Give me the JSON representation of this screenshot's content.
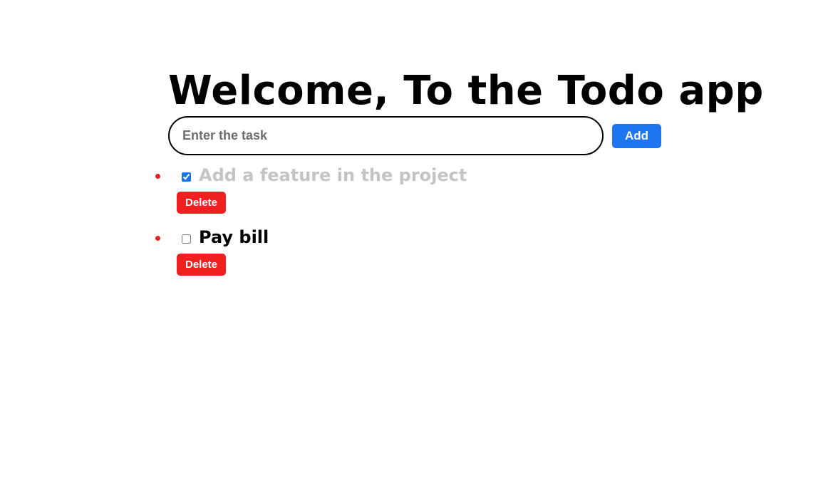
{
  "header": {
    "title": "Welcome, To the Todo app"
  },
  "form": {
    "input_value": "",
    "input_placeholder": "Enter the task",
    "add_label": "Add"
  },
  "todos": [
    {
      "text": "Add a feature in the project",
      "completed": true,
      "delete_label": "Delete"
    },
    {
      "text": "Pay bill",
      "completed": false,
      "delete_label": "Delete"
    }
  ],
  "colors": {
    "add_button": "#1f75ef",
    "delete_button": "#f02020",
    "bullet": "#ee2222",
    "completed_text": "#c4c4c4"
  }
}
